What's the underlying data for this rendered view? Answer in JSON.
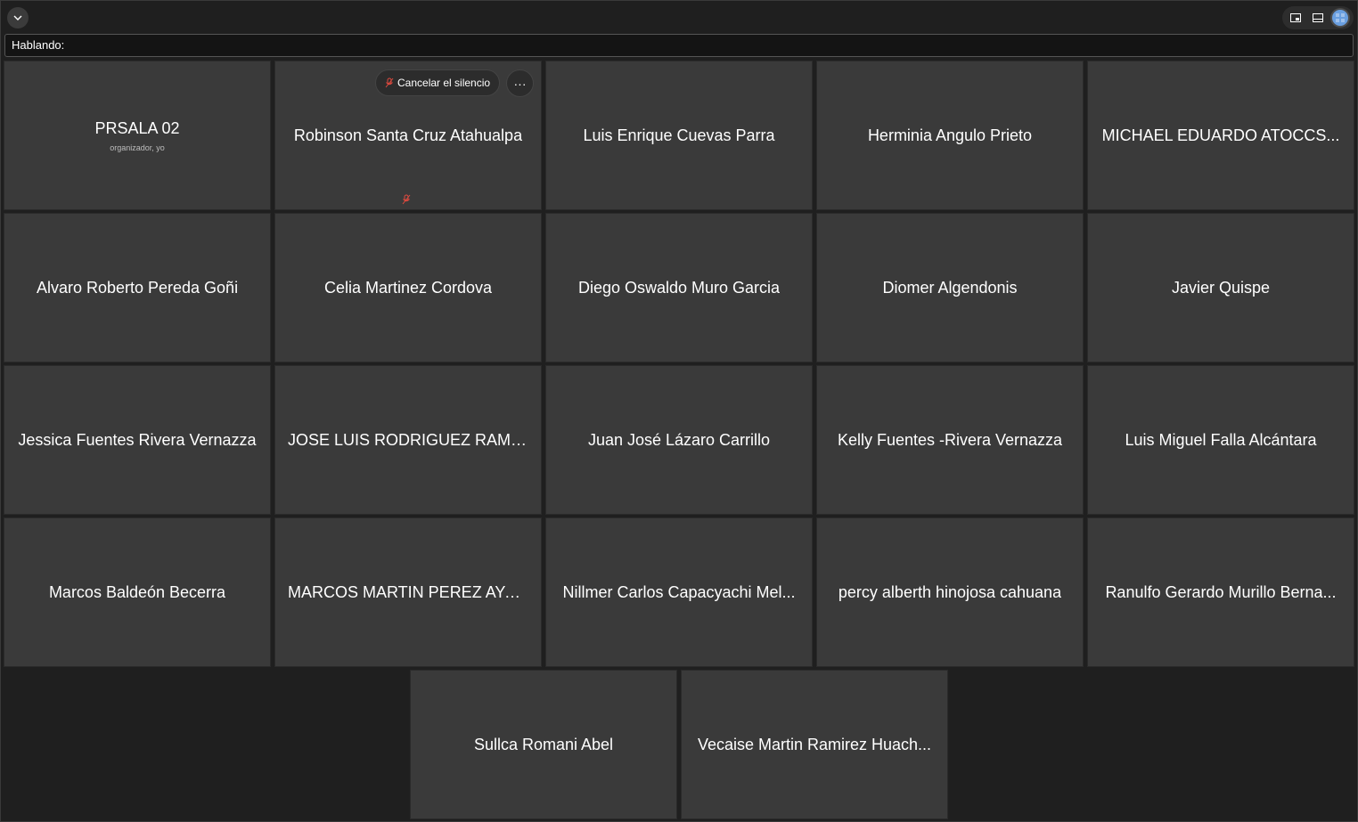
{
  "topbar": {
    "collapse_icon": "chevron-down-icon",
    "view_icons": [
      "picture-in-picture-icon",
      "filmstrip-icon",
      "gallery-view-icon"
    ],
    "active_color": "#6a9fe0"
  },
  "speaking": {
    "label": "Hablando:"
  },
  "controls": {
    "unmute_label": "Cancelar el silencio",
    "more_label": "···",
    "muted_color": "#e04a3f"
  },
  "participants": [
    {
      "name": "PRSALA 02",
      "subtitle": "organizador, yo"
    },
    {
      "name": "Robinson Santa Cruz Atahualpa",
      "subtitle": ""
    },
    {
      "name": "Luis Enrique Cuevas Parra",
      "subtitle": ""
    },
    {
      "name": "Herminia Angulo Prieto",
      "subtitle": ""
    },
    {
      "name": "MICHAEL EDUARDO ATOCCS...",
      "subtitle": ""
    },
    {
      "name": "Alvaro Roberto Pereda Goñi",
      "subtitle": ""
    },
    {
      "name": "Celia Martinez Cordova",
      "subtitle": ""
    },
    {
      "name": "Diego Oswaldo Muro Garcia",
      "subtitle": ""
    },
    {
      "name": "Diomer Algendonis",
      "subtitle": ""
    },
    {
      "name": "Javier Quispe",
      "subtitle": ""
    },
    {
      "name": "Jessica Fuentes Rivera Vernazza",
      "subtitle": ""
    },
    {
      "name": "JOSE LUIS RODRIGUEZ RAMIR...",
      "subtitle": ""
    },
    {
      "name": "Juan José Lázaro Carrillo",
      "subtitle": ""
    },
    {
      "name": "Kelly Fuentes -Rivera Vernazza",
      "subtitle": ""
    },
    {
      "name": "Luis Miguel Falla Alcántara",
      "subtitle": ""
    },
    {
      "name": "Marcos Baldeón Becerra",
      "subtitle": ""
    },
    {
      "name": "MARCOS MARTIN PEREZ AYA...",
      "subtitle": ""
    },
    {
      "name": "Nillmer Carlos Capacyachi Mel...",
      "subtitle": ""
    },
    {
      "name": "percy alberth hinojosa cahuana",
      "subtitle": ""
    },
    {
      "name": "Ranulfo Gerardo Murillo Berna...",
      "subtitle": ""
    },
    {
      "name": "Sullca Romani Abel",
      "subtitle": ""
    },
    {
      "name": "Vecaise Martin Ramirez Huach...",
      "subtitle": ""
    }
  ]
}
